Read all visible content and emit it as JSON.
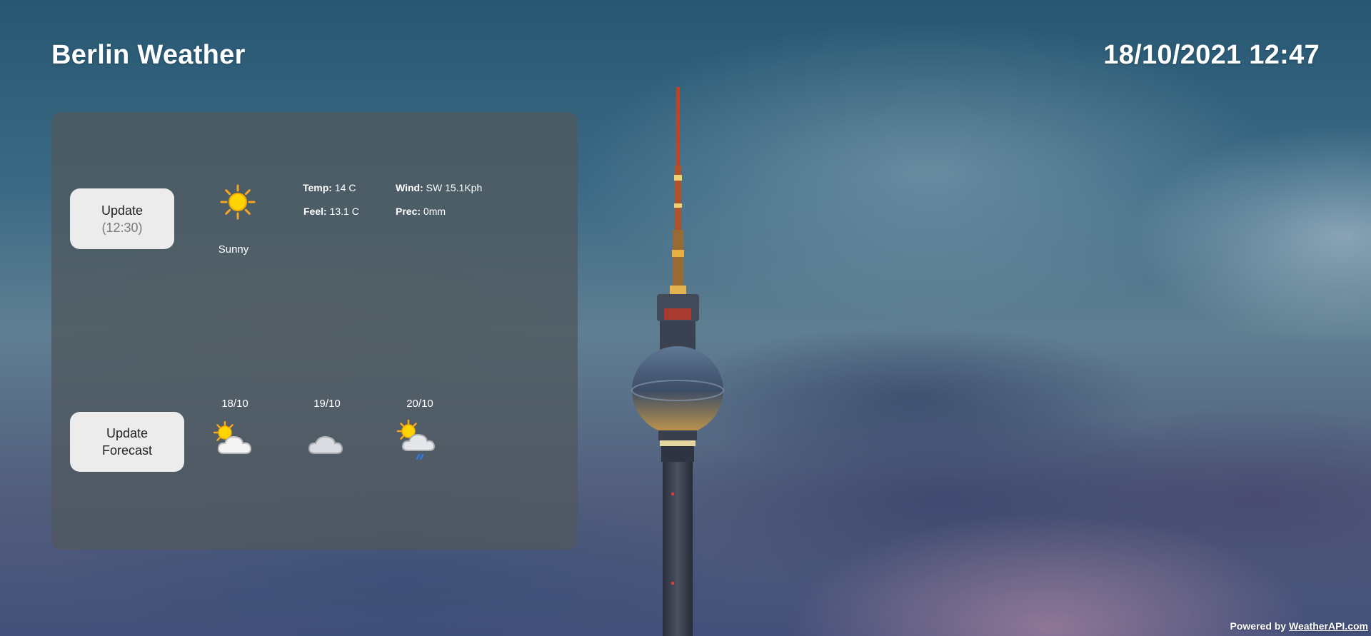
{
  "header": {
    "title": "Berlin Weather",
    "datetime": "18/10/2021 12:47"
  },
  "current": {
    "update_button": {
      "label": "Update",
      "time": "(12:30)"
    },
    "icon": "sun-icon",
    "condition": "Sunny",
    "stats": {
      "temp_label": "Temp:",
      "temp_value": "14 C",
      "feel_label": "Feel:",
      "feel_value": "13.1 C",
      "wind_label": "Wind:",
      "wind_value": "SW 15.1Kph",
      "prec_label": "Prec:",
      "prec_value": "0mm"
    }
  },
  "forecast": {
    "update_button": {
      "line1": "Update",
      "line2": "Forecast"
    },
    "days": [
      {
        "date": "18/10",
        "icon": "partly-cloudy-icon"
      },
      {
        "date": "19/10",
        "icon": "cloud-icon"
      },
      {
        "date": "20/10",
        "icon": "sun-cloud-rain-icon"
      }
    ]
  },
  "footer": {
    "prefix": "Powered by",
    "link": "WeatherAPI.com"
  },
  "colors": {
    "panel": "#50585e",
    "button": "#ececec",
    "sun": "#ffd400",
    "sun_ray": "#f5a623",
    "rain": "#2d7be0"
  }
}
